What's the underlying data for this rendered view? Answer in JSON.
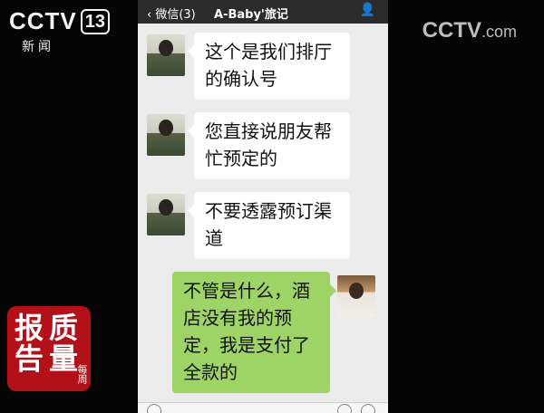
{
  "overlay": {
    "channel_brand": "CCTV",
    "channel_number": "13",
    "channel_sub": "新闻",
    "corner_logo_main": "CCTV",
    "corner_logo_suffix": ".com",
    "program_seal": [
      "质",
      "量",
      "报",
      "告"
    ],
    "program_seal_sub": "每周"
  },
  "chat_header": {
    "back_label": "微信(3)",
    "contact_name": "A-Baby'旅记",
    "profile_icon": "person-icon"
  },
  "messages": [
    {
      "side": "in",
      "text_lines": [
        "这个是我们排厅",
        "的确认号"
      ]
    },
    {
      "side": "in",
      "text_lines": [
        "您直接说朋友帮",
        "忙预定的"
      ]
    },
    {
      "side": "in",
      "text_lines": [
        "不要透露预订渠",
        "道"
      ]
    },
    {
      "side": "out",
      "text_lines": [
        "不管是什么，酒",
        "店没有我的预",
        "定，我是支付了",
        "全款的"
      ]
    }
  ],
  "colors": {
    "outgoing_bubble": "#9ed466",
    "incoming_bubble": "#ffffff",
    "chat_background": "#ececec",
    "header_bar": "#2b2b2b",
    "seal_red": "#b3111a"
  }
}
